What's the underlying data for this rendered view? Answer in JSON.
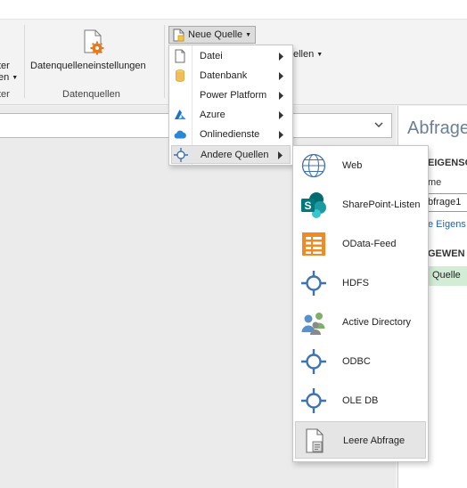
{
  "ribbon": {
    "cut_left_lines": [
      "ter",
      "en"
    ],
    "cut_left_group": "ter",
    "datasource_settings_label": "Datenquelleneinstellungen",
    "group_datasources_label": "Datenquellen",
    "new_source_label": "Neue Quelle",
    "cut_right_label": "ellen"
  },
  "new_source_menu": {
    "items": [
      {
        "label": "Datei",
        "icon": "file-icon"
      },
      {
        "label": "Datenbank",
        "icon": "database-icon"
      },
      {
        "label": "Power Platform",
        "icon": "power-platform-icon"
      },
      {
        "label": "Azure",
        "icon": "azure-icon"
      },
      {
        "label": "Onlinedienste",
        "icon": "cloud-icon"
      },
      {
        "label": "Andere Quellen",
        "icon": "other-sources-icon",
        "highlighted": true
      }
    ]
  },
  "other_sources_menu": {
    "items": [
      {
        "label": "Web",
        "icon": "globe-icon"
      },
      {
        "label": "SharePoint-Listen",
        "icon": "sharepoint-icon"
      },
      {
        "label": "OData-Feed",
        "icon": "odata-icon"
      },
      {
        "label": "HDFS",
        "icon": "hdfs-icon"
      },
      {
        "label": "Active Directory",
        "icon": "active-directory-icon"
      },
      {
        "label": "ODBC",
        "icon": "odbc-icon"
      },
      {
        "label": "OLE DB",
        "icon": "oledb-icon"
      },
      {
        "label": "Leere Abfrage",
        "icon": "blank-query-icon",
        "highlighted": true
      }
    ]
  },
  "query_settings": {
    "header": "Abfrage",
    "properties_section": "EIGENSCHA",
    "name_label": "me",
    "name_value": "bfrage1",
    "all_properties_link": "e Eigens",
    "applied_steps_section": "GEWEN",
    "step": "Quelle"
  },
  "colors": {
    "accent": "#6a7f99",
    "highlight": "#e5e5e5",
    "applied_step": "#d3ecd6",
    "link": "#2565ae"
  }
}
